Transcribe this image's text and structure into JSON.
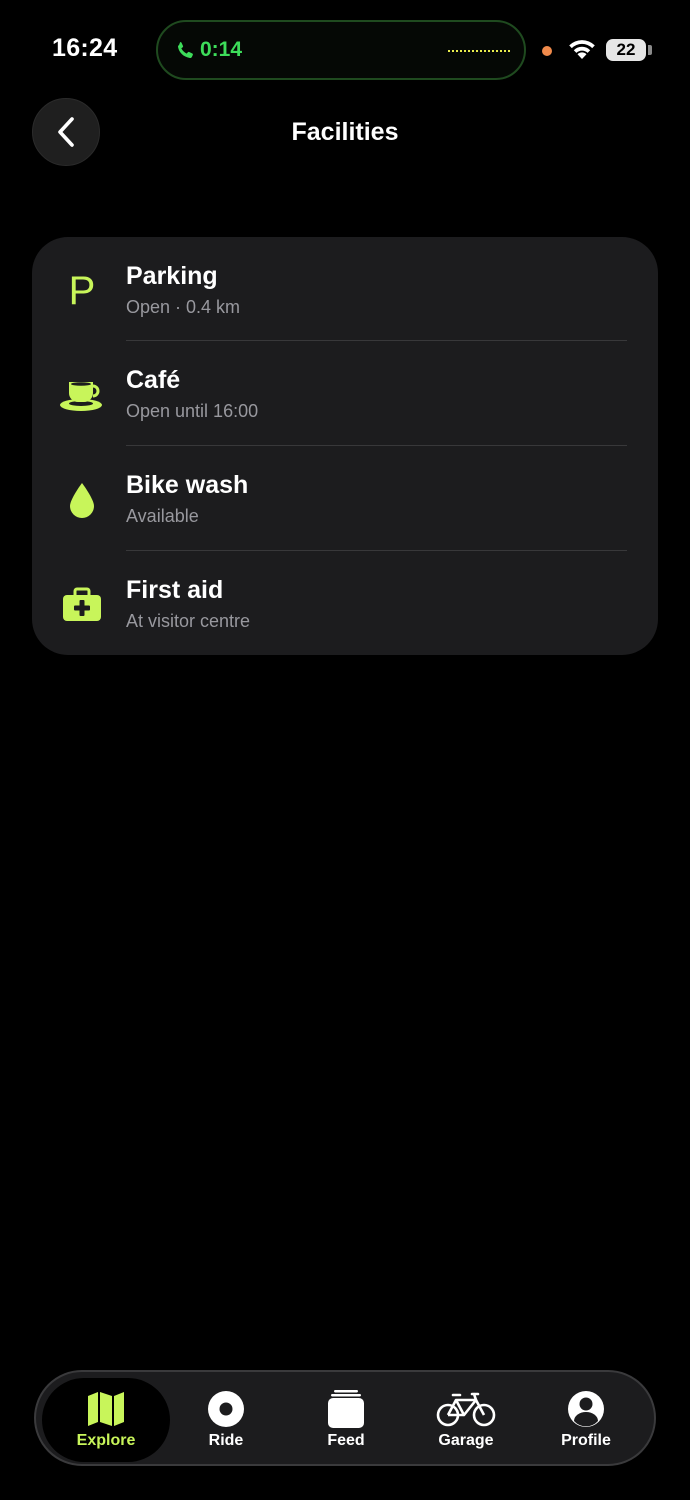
{
  "status_bar": {
    "time": "16:24",
    "call_timer": "0:14",
    "battery": "22"
  },
  "header": {
    "title": "Facilities"
  },
  "facilities": [
    {
      "icon": "parking-icon",
      "title": "Parking",
      "subtitle": "Open · 0.4 km"
    },
    {
      "icon": "coffee-cup-icon",
      "title": "Café",
      "subtitle": "Open until 16:00"
    },
    {
      "icon": "water-drop-icon",
      "title": "Bike wash",
      "subtitle": "Available"
    },
    {
      "icon": "first-aid-kit-icon",
      "title": "First aid",
      "subtitle": "At visitor centre"
    }
  ],
  "tabbar": {
    "tabs": [
      {
        "label": "Explore",
        "icon": "map-icon",
        "active": true
      },
      {
        "label": "Ride",
        "icon": "record-icon",
        "active": false
      },
      {
        "label": "Feed",
        "icon": "stack-icon",
        "active": false
      },
      {
        "label": "Garage",
        "icon": "bicycle-icon",
        "active": false
      },
      {
        "label": "Profile",
        "icon": "person-icon",
        "active": false
      }
    ]
  },
  "colors": {
    "accent": "#c8f55a",
    "card": "#1c1c1e",
    "background": "#000000",
    "secondary_text": "#98989e"
  }
}
